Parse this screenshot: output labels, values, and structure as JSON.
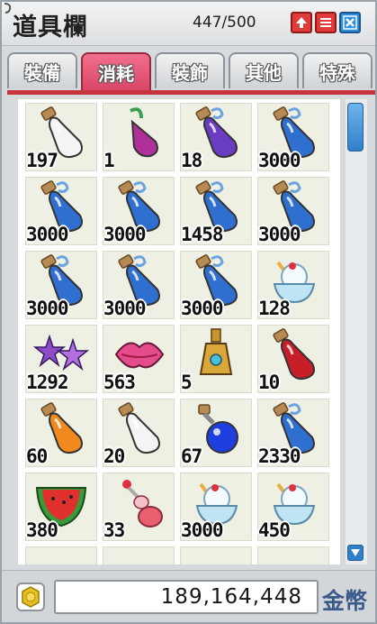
{
  "window": {
    "title": "道具欄",
    "capacity": "447/500",
    "buttons": [
      {
        "name": "expand",
        "icon": "up-arrow-icon",
        "color": "#e03b3b"
      },
      {
        "name": "menu",
        "icon": "list-icon",
        "color": "#e03b3b"
      },
      {
        "name": "close",
        "icon": "close-icon",
        "color": "#2b8ee0"
      }
    ]
  },
  "tabs": [
    {
      "label": "裝備",
      "active": false
    },
    {
      "label": "消耗",
      "active": true
    },
    {
      "label": "裝飾",
      "active": false
    },
    {
      "label": "其他",
      "active": false
    },
    {
      "label": "特殊",
      "active": false
    }
  ],
  "items": [
    {
      "qty": "197",
      "icon": "white-potion-icon",
      "color": "#f4f4f4"
    },
    {
      "qty": "1",
      "icon": "purple-elixir-icon",
      "color": "#b0309a"
    },
    {
      "qty": "18",
      "icon": "purple-potion-icon",
      "color": "#6a3cc0"
    },
    {
      "qty": "3000",
      "icon": "blue-potion-icon",
      "color": "#2f6fd0"
    },
    {
      "qty": "3000",
      "icon": "blue-potion-icon",
      "color": "#2f6fd0"
    },
    {
      "qty": "3000",
      "icon": "blue-potion-icon",
      "color": "#2f6fd0"
    },
    {
      "qty": "1458",
      "icon": "blue-potion-icon",
      "color": "#2f6fd0"
    },
    {
      "qty": "3000",
      "icon": "blue-potion-icon",
      "color": "#2f6fd0"
    },
    {
      "qty": "3000",
      "icon": "blue-potion-icon",
      "color": "#2f6fd0"
    },
    {
      "qty": "3000",
      "icon": "blue-potion-icon",
      "color": "#2f6fd0"
    },
    {
      "qty": "3000",
      "icon": "blue-potion-icon",
      "color": "#2f6fd0"
    },
    {
      "qty": "128",
      "icon": "ice-cream-bowl-icon",
      "color": "#e8f4f8"
    },
    {
      "qty": "1292",
      "icon": "purple-starfish-icon",
      "color": "#8a4cc8"
    },
    {
      "qty": "563",
      "icon": "pink-lips-candy-icon",
      "color": "#e44c8c"
    },
    {
      "qty": "5",
      "icon": "golden-bottle-icon",
      "color": "#c9962e"
    },
    {
      "qty": "10",
      "icon": "red-potion-icon",
      "color": "#c81e2a"
    },
    {
      "qty": "60",
      "icon": "orange-potion-icon",
      "color": "#f08a1e"
    },
    {
      "qty": "20",
      "icon": "white-potion-icon",
      "color": "#f4f4f4"
    },
    {
      "qty": "67",
      "icon": "blue-round-potion-icon",
      "color": "#1e3ee0"
    },
    {
      "qty": "2330",
      "icon": "blue-potion-icon",
      "color": "#2f6fd0"
    },
    {
      "qty": "380",
      "icon": "watermelon-slice-icon",
      "color": "#e0302e"
    },
    {
      "qty": "33",
      "icon": "pink-gourd-bottle-icon",
      "color": "#e86070"
    },
    {
      "qty": "3000",
      "icon": "ice-cream-bowl-icon",
      "color": "#e8f4f8"
    },
    {
      "qty": "450",
      "icon": "ice-cream-bowl-icon",
      "color": "#e8f4f8"
    },
    {
      "qty": "",
      "icon": "brown-item-icon",
      "color": "#8a5a2a"
    },
    {
      "qty": "",
      "icon": "yellow-item-icon",
      "color": "#e8c040"
    },
    {
      "qty": "",
      "icon": "green-item-icon",
      "color": "#3a8a3a"
    },
    {
      "qty": "",
      "icon": "purple-item-icon",
      "color": "#6a3cb0"
    }
  ],
  "footer": {
    "coin_icon": "gold-coin-icon",
    "gold": "189,164,448",
    "gold_label": "金幣"
  },
  "colors": {
    "accent_red": "#c8343d",
    "active_tab": "#e5567a",
    "scroll_blue": "#2f7fc9"
  }
}
